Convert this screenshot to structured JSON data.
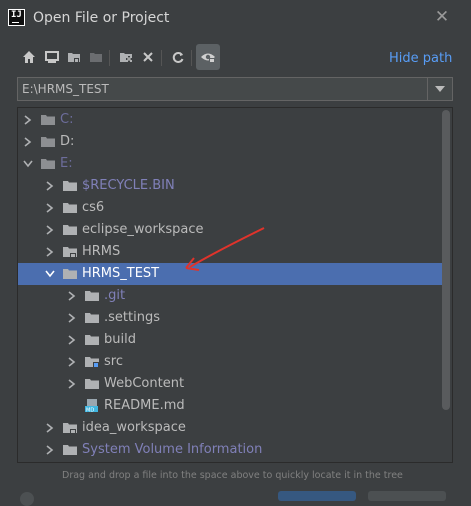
{
  "window": {
    "title": "Open File or Project",
    "close_glyph": "✕"
  },
  "toolbar": {
    "buttons": [
      {
        "name": "home-icon"
      },
      {
        "name": "desktop-icon"
      },
      {
        "name": "project-directory-icon"
      },
      {
        "name": "module-directory-icon"
      },
      {
        "name": "new-folder-icon"
      },
      {
        "name": "delete-icon"
      },
      {
        "name": "refresh-icon"
      },
      {
        "name": "show-hidden-files-icon"
      }
    ],
    "hide_path_label": "Hide path"
  },
  "path": {
    "value": "E:\\HRMS_TEST"
  },
  "tree": {
    "rows": [
      {
        "label": "C:",
        "state": "collapsed",
        "style": "muted",
        "icon": "drive"
      },
      {
        "label": "D:",
        "state": "collapsed",
        "style": "normal",
        "icon": "drive"
      },
      {
        "label": "E:",
        "state": "expanded",
        "style": "muted",
        "icon": "drive"
      },
      {
        "label": "$RECYCLE.BIN",
        "state": "collapsed",
        "style": "dim",
        "icon": "folder"
      },
      {
        "label": "cs6",
        "state": "collapsed",
        "style": "normal",
        "icon": "folder"
      },
      {
        "label": "eclipse_workspace",
        "state": "collapsed",
        "style": "normal",
        "icon": "folder"
      },
      {
        "label": "HRMS",
        "state": "collapsed",
        "style": "normal",
        "icon": "project-folder"
      },
      {
        "label": "HRMS_TEST",
        "state": "expanded",
        "style": "selected",
        "icon": "folder"
      },
      {
        "label": ".git",
        "state": "collapsed",
        "style": "dim",
        "icon": "folder"
      },
      {
        "label": ".settings",
        "state": "collapsed",
        "style": "normal",
        "icon": "folder"
      },
      {
        "label": "build",
        "state": "collapsed",
        "style": "normal",
        "icon": "folder"
      },
      {
        "label": "src",
        "state": "collapsed",
        "style": "normal",
        "icon": "source-folder"
      },
      {
        "label": "WebContent",
        "state": "collapsed",
        "style": "normal",
        "icon": "folder"
      },
      {
        "label": "README.md",
        "state": "leaf",
        "style": "normal",
        "icon": "markdown-file"
      },
      {
        "label": "idea_workspace",
        "state": "collapsed",
        "style": "normal",
        "icon": "project-folder"
      },
      {
        "label": "System Volume Information",
        "state": "collapsed",
        "style": "dim",
        "icon": "folder"
      },
      {
        "label": "",
        "state": "collapsed",
        "style": "normal",
        "icon": "folder"
      }
    ]
  },
  "hint": "Drag and drop a file into the space above to quickly locate it in the tree",
  "colors": {
    "background": "#3c3f41",
    "selection": "#4b6eaf",
    "link": "#589df6",
    "annotation_arrow": "#e0332b"
  }
}
